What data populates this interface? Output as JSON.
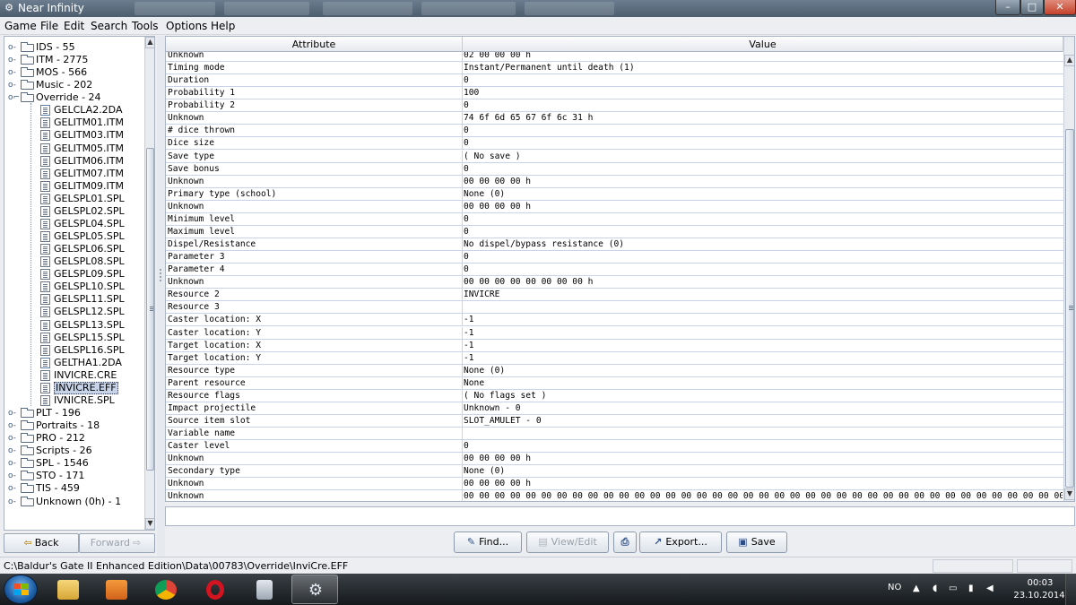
{
  "window": {
    "title": "Near Infinity"
  },
  "menu": [
    "Game",
    "File",
    "Edit",
    "Search",
    "Tools",
    "Options",
    "Help"
  ],
  "tree": [
    {
      "type": "folder",
      "label": "IDS - 55",
      "level": 0
    },
    {
      "type": "folder",
      "label": "ITM - 2775",
      "level": 0
    },
    {
      "type": "folder",
      "label": "MOS - 566",
      "level": 0
    },
    {
      "type": "folder",
      "label": "Music - 202",
      "level": 0
    },
    {
      "type": "folder-open",
      "label": "Override - 24",
      "level": 0
    },
    {
      "type": "doc",
      "label": "GELCLA2.2DA",
      "level": 1
    },
    {
      "type": "file",
      "label": "GELITM01.ITM",
      "level": 1
    },
    {
      "type": "file",
      "label": "GELITM03.ITM",
      "level": 1
    },
    {
      "type": "file",
      "label": "GELITM05.ITM",
      "level": 1
    },
    {
      "type": "file",
      "label": "GELITM06.ITM",
      "level": 1
    },
    {
      "type": "file",
      "label": "GELITM07.ITM",
      "level": 1
    },
    {
      "type": "file",
      "label": "GELITM09.ITM",
      "level": 1
    },
    {
      "type": "file",
      "label": "GELSPL01.SPL",
      "level": 1
    },
    {
      "type": "file",
      "label": "GELSPL02.SPL",
      "level": 1
    },
    {
      "type": "file",
      "label": "GELSPL04.SPL",
      "level": 1
    },
    {
      "type": "file",
      "label": "GELSPL05.SPL",
      "level": 1
    },
    {
      "type": "file",
      "label": "GELSPL06.SPL",
      "level": 1
    },
    {
      "type": "file",
      "label": "GELSPL08.SPL",
      "level": 1
    },
    {
      "type": "file",
      "label": "GELSPL09.SPL",
      "level": 1
    },
    {
      "type": "file",
      "label": "GELSPL10.SPL",
      "level": 1
    },
    {
      "type": "file",
      "label": "GELSPL11.SPL",
      "level": 1
    },
    {
      "type": "file",
      "label": "GELSPL12.SPL",
      "level": 1
    },
    {
      "type": "file",
      "label": "GELSPL13.SPL",
      "level": 1
    },
    {
      "type": "file",
      "label": "GELSPL15.SPL",
      "level": 1
    },
    {
      "type": "file",
      "label": "GELSPL16.SPL",
      "level": 1
    },
    {
      "type": "doc",
      "label": "GELTHA1.2DA",
      "level": 1
    },
    {
      "type": "file",
      "label": "INVICRE.CRE",
      "level": 1
    },
    {
      "type": "file",
      "label": "INVICRE.EFF",
      "level": 1,
      "selected": true
    },
    {
      "type": "file",
      "label": "IVNICRE.SPL",
      "level": 1
    },
    {
      "type": "folder",
      "label": "PLT - 196",
      "level": 0
    },
    {
      "type": "folder",
      "label": "Portraits - 18",
      "level": 0
    },
    {
      "type": "folder",
      "label": "PRO - 212",
      "level": 0
    },
    {
      "type": "folder",
      "label": "Scripts - 26",
      "level": 0
    },
    {
      "type": "folder",
      "label": "SPL - 1546",
      "level": 0
    },
    {
      "type": "folder",
      "label": "STO - 171",
      "level": 0
    },
    {
      "type": "folder",
      "label": "TIS - 459",
      "level": 0
    },
    {
      "type": "folder",
      "label": "Unknown (0h) - 1",
      "level": 0
    }
  ],
  "nav": {
    "back": "Back",
    "forward": "Forward"
  },
  "table": {
    "headers": [
      "Attribute",
      "Value"
    ],
    "rows": [
      [
        "Unknown",
        "02 00 00 00 h"
      ],
      [
        "Timing mode",
        "Instant/Permanent until death (1)"
      ],
      [
        "Duration",
        "0"
      ],
      [
        "Probability 1",
        "100"
      ],
      [
        "Probability 2",
        "0"
      ],
      [
        "Unknown",
        "74 6f 6d 65 67 6f 6c 31 h"
      ],
      [
        "# dice thrown",
        "0"
      ],
      [
        "Dice size",
        "0"
      ],
      [
        "Save type",
        "( No save )"
      ],
      [
        "Save bonus",
        "0"
      ],
      [
        "Unknown",
        "00 00 00 00 h"
      ],
      [
        "Primary type (school)",
        "None (0)"
      ],
      [
        "Unknown",
        "00 00 00 00 h"
      ],
      [
        "Minimum level",
        "0"
      ],
      [
        "Maximum level",
        "0"
      ],
      [
        "Dispel/Resistance",
        "No dispel/bypass resistance (0)"
      ],
      [
        "Parameter 3",
        "0"
      ],
      [
        "Parameter 4",
        "0"
      ],
      [
        "Unknown",
        "00 00 00 00 00 00 00 00 h"
      ],
      [
        "Resource 2",
        "INVICRE"
      ],
      [
        "Resource 3",
        ""
      ],
      [
        "Caster location: X",
        "-1"
      ],
      [
        "Caster location: Y",
        "-1"
      ],
      [
        "Target location: X",
        "-1"
      ],
      [
        "Target location: Y",
        "-1"
      ],
      [
        "Resource type",
        "None (0)"
      ],
      [
        "Parent resource",
        "None"
      ],
      [
        "Resource flags",
        "( No flags set )"
      ],
      [
        "Impact projectile",
        "Unknown - 0"
      ],
      [
        "Source item slot",
        "SLOT_AMULET - 0"
      ],
      [
        "Variable name",
        ""
      ],
      [
        "Caster level",
        "0"
      ],
      [
        "Unknown",
        "00 00 00 00 h"
      ],
      [
        "Secondary type",
        "None (0)"
      ],
      [
        "Unknown",
        "00 00 00 00 h"
      ],
      [
        "Unknown",
        "00 00 00 00 00 00 00 00 00 00 00 00 00 00 00 00 00 00 00 00 00 00 00 00 00 00 00 00 00 00 00 00 00 00 00 00 00 00 00 00 00 00 00 00 00 00 00 00 00 00 00 00 00 00 00 00 00 00 00 00 00 00 00 00 00 00 00 00 00 00 00 00 00 00 ..."
      ]
    ]
  },
  "actions": {
    "find": "Find...",
    "view_edit": "View/Edit",
    "export": "Export...",
    "save": "Save"
  },
  "status": {
    "path": "C:\\Baldur's Gate II Enhanced Edition\\Data\\00783\\Override\\InviCre.EFF"
  },
  "taskbar": {
    "lang": "NO",
    "time": "00:03",
    "date": "23.10.2014",
    "apps": [
      "explorer-icon",
      "media-player-icon",
      "chrome-icon",
      "opera-icon",
      "calculator-icon",
      "near-infinity-icon"
    ]
  },
  "colors": {
    "selection": "#c6d3e8",
    "grid": "#c8d4e8",
    "titlebar": "#5a6b7c",
    "close": "#c4412a"
  }
}
